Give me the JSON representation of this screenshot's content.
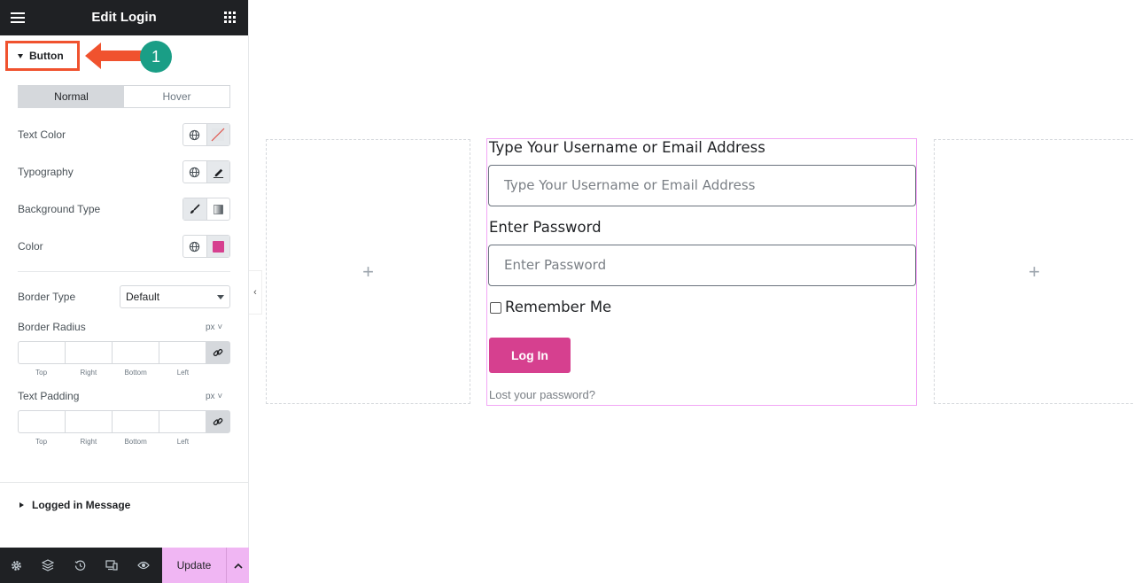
{
  "panel": {
    "title": "Edit Login",
    "section_open": "Button",
    "step_badge": "1",
    "tabs": [
      "Normal",
      "Hover"
    ],
    "active_tab": "Normal",
    "rows": {
      "text_color": "Text Color",
      "typography": "Typography",
      "background_type": "Background Type",
      "color": "Color"
    },
    "color_swatch": "#d6408f",
    "border_type_label": "Border Type",
    "border_type_value": "Default",
    "border_radius_label": "Border Radius",
    "text_padding_label": "Text Padding",
    "unit": "px",
    "dim_labels": [
      "Top",
      "Right",
      "Bottom",
      "Left"
    ],
    "section_closed": "Logged in Message"
  },
  "footer": {
    "update_label": "Update"
  },
  "canvas": {
    "add_symbol": "+",
    "username_label": "Type Your Username or Email Address",
    "username_placeholder": "Type Your Username or Email Address",
    "password_label": "Enter Password",
    "password_placeholder": "Enter Password",
    "remember_label": "Remember Me",
    "login_button": "Log In",
    "lost_password": "Lost your password?"
  },
  "colors": {
    "accent": "#d6408f",
    "highlight": "#f0522e",
    "badge": "#1a9e86",
    "update_bg": "#f0b6f3"
  }
}
